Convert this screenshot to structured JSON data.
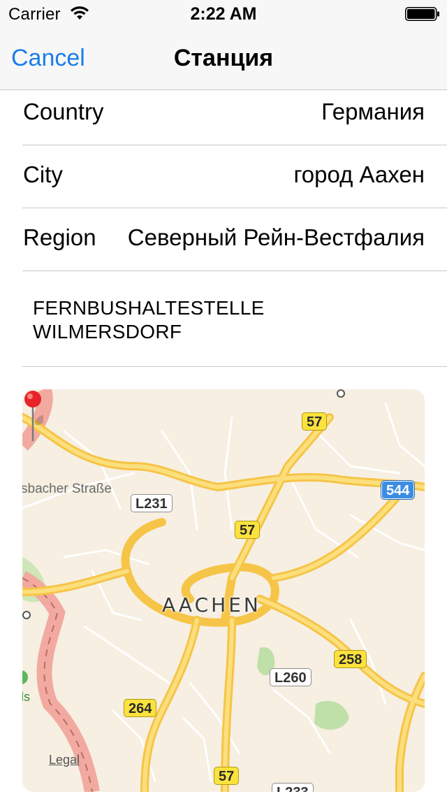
{
  "status_bar": {
    "carrier": "Carrier",
    "time": "2:22 AM"
  },
  "nav": {
    "cancel_label": "Cancel",
    "title": "Станция"
  },
  "rows": {
    "country": {
      "label": "Country",
      "value": "Германия"
    },
    "city": {
      "label": "City",
      "value": "город Аахен"
    },
    "region": {
      "label": "Region",
      "value": "Северный Рейн-Вестфалия"
    }
  },
  "address": {
    "line1": "FERNBUSHALTESTELLE",
    "line2": "WILMERSDORF"
  },
  "map": {
    "city_label": "AACHEN",
    "street_label": "sbacher Straße",
    "park_label": "ls",
    "legal_label": "Legal",
    "shields": {
      "a57_top": "57",
      "a57_mid": "57",
      "a57_bottom": "57",
      "a544": "544",
      "l231": "L231",
      "b258": "258",
      "l260": "L260",
      "b264": "264",
      "l233": "L233"
    },
    "colors": {
      "background": "#f6efe2",
      "major_road": "#fbd25a",
      "minor_road": "#ffffff",
      "border": "#f2aaa0",
      "park": "#bfe0a8"
    }
  },
  "colors": {
    "accent": "#1a7ee8",
    "separator": "#c8c7cc",
    "bar_background": "#f7f7f7",
    "pin": "#e8232a"
  }
}
